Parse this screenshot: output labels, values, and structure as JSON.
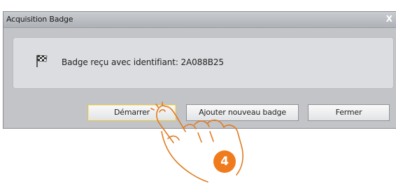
{
  "window": {
    "title": "Acquisition Badge",
    "close_glyph": "X"
  },
  "message": {
    "icon": "checkered-flag-icon",
    "text": "Badge reçu avec identifiant: 2A088B25"
  },
  "buttons": {
    "start_label": "Démarrer",
    "add_label": "Ajouter nouveau badge",
    "close_label": "Fermer"
  },
  "annotation": {
    "step_number": "4",
    "step_color": "#f07b1c"
  }
}
